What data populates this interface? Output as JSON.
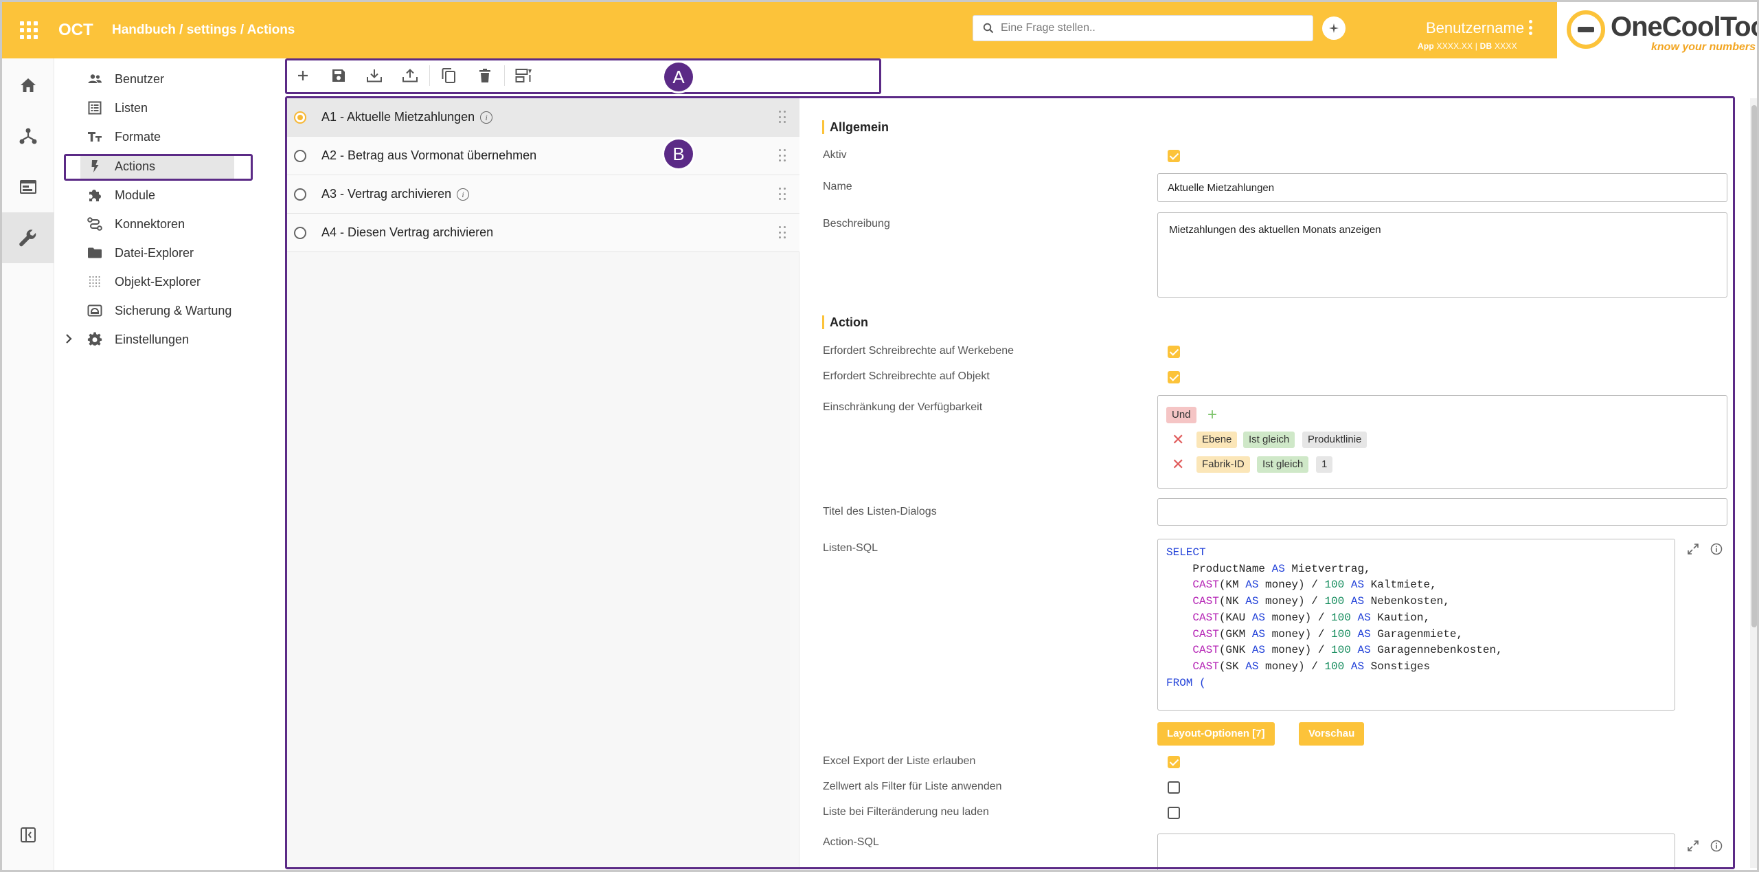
{
  "header": {
    "app_title": "OCT",
    "breadcrumb": "Handbuch / settings / Actions",
    "search_placeholder": "Eine Frage stellen..",
    "username": "Benutzername",
    "app_label": "App",
    "app_value": "XXXX.XX",
    "separator": "|",
    "db_label": "DB",
    "db_value": "XXXX",
    "logo_text": "OneCoolTool",
    "logo_tagline": "know your numbers",
    "accent_color": "#fcc33a"
  },
  "rail": {
    "items": [
      "home-icon",
      "hierarchy-icon",
      "browser-icon",
      "wrench-icon"
    ],
    "active_index": 3
  },
  "settings_nav": {
    "items": [
      {
        "label": "Benutzer",
        "icon": "users-icon"
      },
      {
        "label": "Listen",
        "icon": "list-icon"
      },
      {
        "label": "Formate",
        "icon": "text-format-icon"
      },
      {
        "label": "Actions",
        "icon": "flash-icon"
      },
      {
        "label": "Module",
        "icon": "puzzle-icon"
      },
      {
        "label": "Konnektoren",
        "icon": "connector-icon"
      },
      {
        "label": "Datei-Explorer",
        "icon": "folder-icon"
      },
      {
        "label": "Objekt-Explorer",
        "icon": "grid-dots-icon"
      },
      {
        "label": "Sicherung & Wartung",
        "icon": "backup-icon"
      },
      {
        "label": "Einstellungen",
        "icon": "gear-icon"
      }
    ],
    "active": "Actions"
  },
  "toolbar": {
    "buttons": [
      "add-icon",
      "save-icon",
      "download-icon",
      "upload-icon",
      "copy-icon",
      "delete-icon",
      "reorder-icon"
    ]
  },
  "annotations": {
    "a": "A",
    "b": "B",
    "highlight_color": "#5b2a86"
  },
  "actions": [
    {
      "label": "A1 - Aktuelle Mietzahlungen",
      "info": true,
      "selected": true
    },
    {
      "label": "A2 - Betrag aus Vormonat übernehmen",
      "info": false,
      "selected": false
    },
    {
      "label": "A3 - Vertrag archivieren",
      "info": true,
      "selected": false
    },
    {
      "label": "A4 - Diesen Vertrag archivieren",
      "info": false,
      "selected": false
    }
  ],
  "detail": {
    "section_general": "Allgemein",
    "active_label": "Aktiv",
    "active_value": true,
    "name_label": "Name",
    "name_value": "Aktuelle Mietzahlungen",
    "description_label": "Beschreibung",
    "description_value": "Mietzahlungen des aktuellen Monats anzeigen",
    "section_action": "Action",
    "req_write_level_label": "Erfordert Schreibrechte auf Werkebene",
    "req_write_level_value": true,
    "req_write_object_label": "Erfordert Schreibrechte auf Objekt",
    "req_write_object_value": true,
    "restriction_label": "Einschränkung der Verfügbarkeit",
    "restriction_operator": "Und",
    "restriction_add": "+",
    "restriction_remove": "✕",
    "restriction_rules": [
      {
        "field": "Ebene",
        "op": "Ist gleich",
        "value": "Produktlinie"
      },
      {
        "field": "Fabrik-ID",
        "op": "Ist gleich",
        "value": "1"
      }
    ],
    "dialog_title_label": "Titel des Listen-Dialogs",
    "dialog_title_value": "",
    "list_sql_label": "Listen-SQL",
    "list_sql_lines": [
      [
        {
          "t": "SELECT",
          "c": "kw"
        }
      ],
      [
        {
          "t": "    ProductName ",
          "c": ""
        },
        {
          "t": "AS",
          "c": "kw"
        },
        {
          "t": " Mietvertrag,",
          "c": ""
        }
      ],
      [
        {
          "t": "    ",
          "c": ""
        },
        {
          "t": "CAST",
          "c": "fn"
        },
        {
          "t": "(KM ",
          "c": ""
        },
        {
          "t": "AS",
          "c": "kw"
        },
        {
          "t": " money) / ",
          "c": ""
        },
        {
          "t": "100",
          "c": "num"
        },
        {
          "t": " ",
          "c": ""
        },
        {
          "t": "AS",
          "c": "kw"
        },
        {
          "t": " Kaltmiete,",
          "c": ""
        }
      ],
      [
        {
          "t": "    ",
          "c": ""
        },
        {
          "t": "CAST",
          "c": "fn"
        },
        {
          "t": "(NK ",
          "c": ""
        },
        {
          "t": "AS",
          "c": "kw"
        },
        {
          "t": " money) / ",
          "c": ""
        },
        {
          "t": "100",
          "c": "num"
        },
        {
          "t": " ",
          "c": ""
        },
        {
          "t": "AS",
          "c": "kw"
        },
        {
          "t": " Nebenkosten,",
          "c": ""
        }
      ],
      [
        {
          "t": "    ",
          "c": ""
        },
        {
          "t": "CAST",
          "c": "fn"
        },
        {
          "t": "(KAU ",
          "c": ""
        },
        {
          "t": "AS",
          "c": "kw"
        },
        {
          "t": " money) / ",
          "c": ""
        },
        {
          "t": "100",
          "c": "num"
        },
        {
          "t": " ",
          "c": ""
        },
        {
          "t": "AS",
          "c": "kw"
        },
        {
          "t": " Kaution,",
          "c": ""
        }
      ],
      [
        {
          "t": "    ",
          "c": ""
        },
        {
          "t": "CAST",
          "c": "fn"
        },
        {
          "t": "(GKM ",
          "c": ""
        },
        {
          "t": "AS",
          "c": "kw"
        },
        {
          "t": " money) / ",
          "c": ""
        },
        {
          "t": "100",
          "c": "num"
        },
        {
          "t": " ",
          "c": ""
        },
        {
          "t": "AS",
          "c": "kw"
        },
        {
          "t": " Garagenmiete,",
          "c": ""
        }
      ],
      [
        {
          "t": "    ",
          "c": ""
        },
        {
          "t": "CAST",
          "c": "fn"
        },
        {
          "t": "(GNK ",
          "c": ""
        },
        {
          "t": "AS",
          "c": "kw"
        },
        {
          "t": " money) / ",
          "c": ""
        },
        {
          "t": "100",
          "c": "num"
        },
        {
          "t": " ",
          "c": ""
        },
        {
          "t": "AS",
          "c": "kw"
        },
        {
          "t": " Garagennebenkosten,",
          "c": ""
        }
      ],
      [
        {
          "t": "    ",
          "c": ""
        },
        {
          "t": "CAST",
          "c": "fn"
        },
        {
          "t": "(SK ",
          "c": ""
        },
        {
          "t": "AS",
          "c": "kw"
        },
        {
          "t": " money) / ",
          "c": ""
        },
        {
          "t": "100",
          "c": "num"
        },
        {
          "t": " ",
          "c": ""
        },
        {
          "t": "AS",
          "c": "kw"
        },
        {
          "t": " Sonstiges",
          "c": ""
        }
      ],
      [
        {
          "t": "FROM (",
          "c": "kw"
        }
      ]
    ],
    "layout_options_button": "Layout-Optionen [7]",
    "preview_button": "Vorschau",
    "excel_export_label": "Excel Export der Liste erlauben",
    "excel_export_value": true,
    "cell_filter_label": "Zellwert als Filter für Liste anwenden",
    "cell_filter_value": false,
    "reload_label": "Liste bei Filteränderung neu laden",
    "reload_value": false,
    "action_sql_label": "Action-SQL"
  }
}
